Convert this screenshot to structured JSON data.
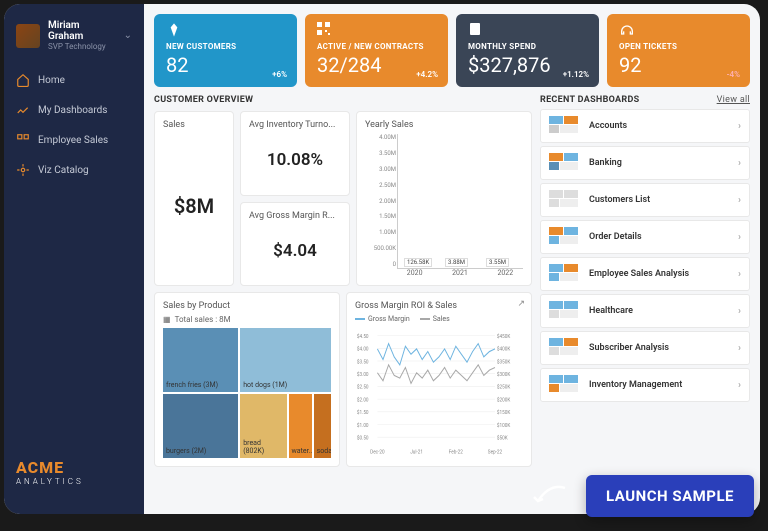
{
  "profile": {
    "name": "Miriam Graham",
    "role": "SVP Technology"
  },
  "nav": [
    {
      "label": "Home"
    },
    {
      "label": "My Dashboards"
    },
    {
      "label": "Employee Sales"
    },
    {
      "label": "Viz Catalog"
    }
  ],
  "logo": {
    "brand": "ACME",
    "sub": "ANALYTICS"
  },
  "cards": [
    {
      "title": "NEW CUSTOMERS",
      "value": "82",
      "delta": "+6%",
      "cls": "card-blue",
      "icon": "diamond"
    },
    {
      "title": "ACTIVE / NEW CONTRACTS",
      "value": "32/284",
      "delta": "+4.2%",
      "cls": "card-orange",
      "icon": "qr"
    },
    {
      "title": "MONTHLY SPEND",
      "value": "$327,876",
      "delta": "+1.12%",
      "cls": "card-dark",
      "icon": "page"
    },
    {
      "title": "OPEN TICKETS",
      "value": "92",
      "delta": "-4%",
      "cls": "card-orange",
      "icon": "headset",
      "neg": true
    }
  ],
  "sections": {
    "overview": "CUSTOMER OVERVIEW",
    "recent": "RECENT DASHBOARDS",
    "view_all": "View all"
  },
  "tiles": {
    "sales": {
      "title": "Sales",
      "value": "$8M"
    },
    "inv": {
      "title": "Avg Inventory Turno...",
      "value": "10.08%"
    },
    "margin": {
      "title": "Avg Gross Margin R...",
      "value": "$4.04"
    },
    "yearly": {
      "title": "Yearly Sales"
    },
    "sbp": {
      "title": "Sales by Product",
      "total": "Total sales : 8M"
    },
    "roi": {
      "title": "Gross Margin ROI & Sales",
      "legend": [
        "Gross Margin",
        "Sales"
      ]
    }
  },
  "chart_data": {
    "yearly_sales": {
      "type": "bar",
      "categories": [
        "2020",
        "2021",
        "2022"
      ],
      "values": [
        126580,
        3880000,
        3550000
      ],
      "labels": [
        "126.58K",
        "3.88M",
        "3.55M"
      ],
      "ylabels": [
        "4.00M",
        "3.50M",
        "3.00M",
        "2.50M",
        "2.00M",
        "1.50M",
        "1.00M",
        "500.00K",
        "0"
      ],
      "ylim": [
        0,
        4000000
      ],
      "title": "Yearly Sales"
    },
    "sales_by_product": {
      "type": "treemap",
      "total_label": "Total sales : 8M",
      "items": [
        {
          "name": "french fries (3M)",
          "value": 3000000,
          "color": "#5a8fb5"
        },
        {
          "name": "burgers (2M)",
          "value": 2000000,
          "color": "#4a7599"
        },
        {
          "name": "hot dogs (1M)",
          "value": 1000000,
          "color": "#8fbdd8"
        },
        {
          "name": "bread (802K)",
          "value": 802000,
          "color": "#e0b868"
        },
        {
          "name": "water...",
          "value": 500000,
          "color": "#e88a2c"
        },
        {
          "name": "soda...",
          "value": 400000,
          "color": "#c56f1f"
        }
      ]
    },
    "gross_margin_roi": {
      "type": "line",
      "x": [
        "Dec-20",
        "Jul-21",
        "Feb-22",
        "Sep-22"
      ],
      "yleft_labels": [
        "$4.50",
        "$4.00",
        "$3.50",
        "$3.00",
        "$2.50",
        "$2.00",
        "$1.50",
        "$1.00",
        "$0.50"
      ],
      "yright_labels": [
        "$450K",
        "$400K",
        "$350K",
        "$300K",
        "$250K",
        "$200K",
        "$150K",
        "$100K",
        "$50K"
      ],
      "series": [
        {
          "name": "Gross Margin",
          "color": "#6eb4e0",
          "values": [
            4.0,
            3.6,
            4.2,
            3.7,
            3.4,
            4.1,
            3.8,
            4.0,
            3.6,
            3.9,
            3.5,
            3.7,
            4.0,
            3.6,
            4.1,
            3.8,
            3.5,
            3.9,
            4.2,
            3.7,
            3.9,
            4.0
          ]
        },
        {
          "name": "Sales",
          "color": "#a8a8a8",
          "values": [
            3.1,
            2.8,
            3.4,
            3.0,
            2.9,
            3.3,
            2.7,
            3.1,
            2.9,
            3.2,
            2.8,
            3.0,
            3.3,
            2.9,
            3.2,
            3.0,
            2.8,
            3.1,
            3.4,
            3.0,
            3.2,
            3.3
          ]
        }
      ],
      "ylim": [
        0.5,
        4.5
      ]
    }
  },
  "dashboards": [
    {
      "label": "Accounts"
    },
    {
      "label": "Banking"
    },
    {
      "label": "Customers List"
    },
    {
      "label": "Order Details"
    },
    {
      "label": "Employee Sales Analysis"
    },
    {
      "label": "Healthcare"
    },
    {
      "label": "Subscriber Analysis"
    },
    {
      "label": "Inventory Management"
    }
  ],
  "launch": "LAUNCH SAMPLE"
}
